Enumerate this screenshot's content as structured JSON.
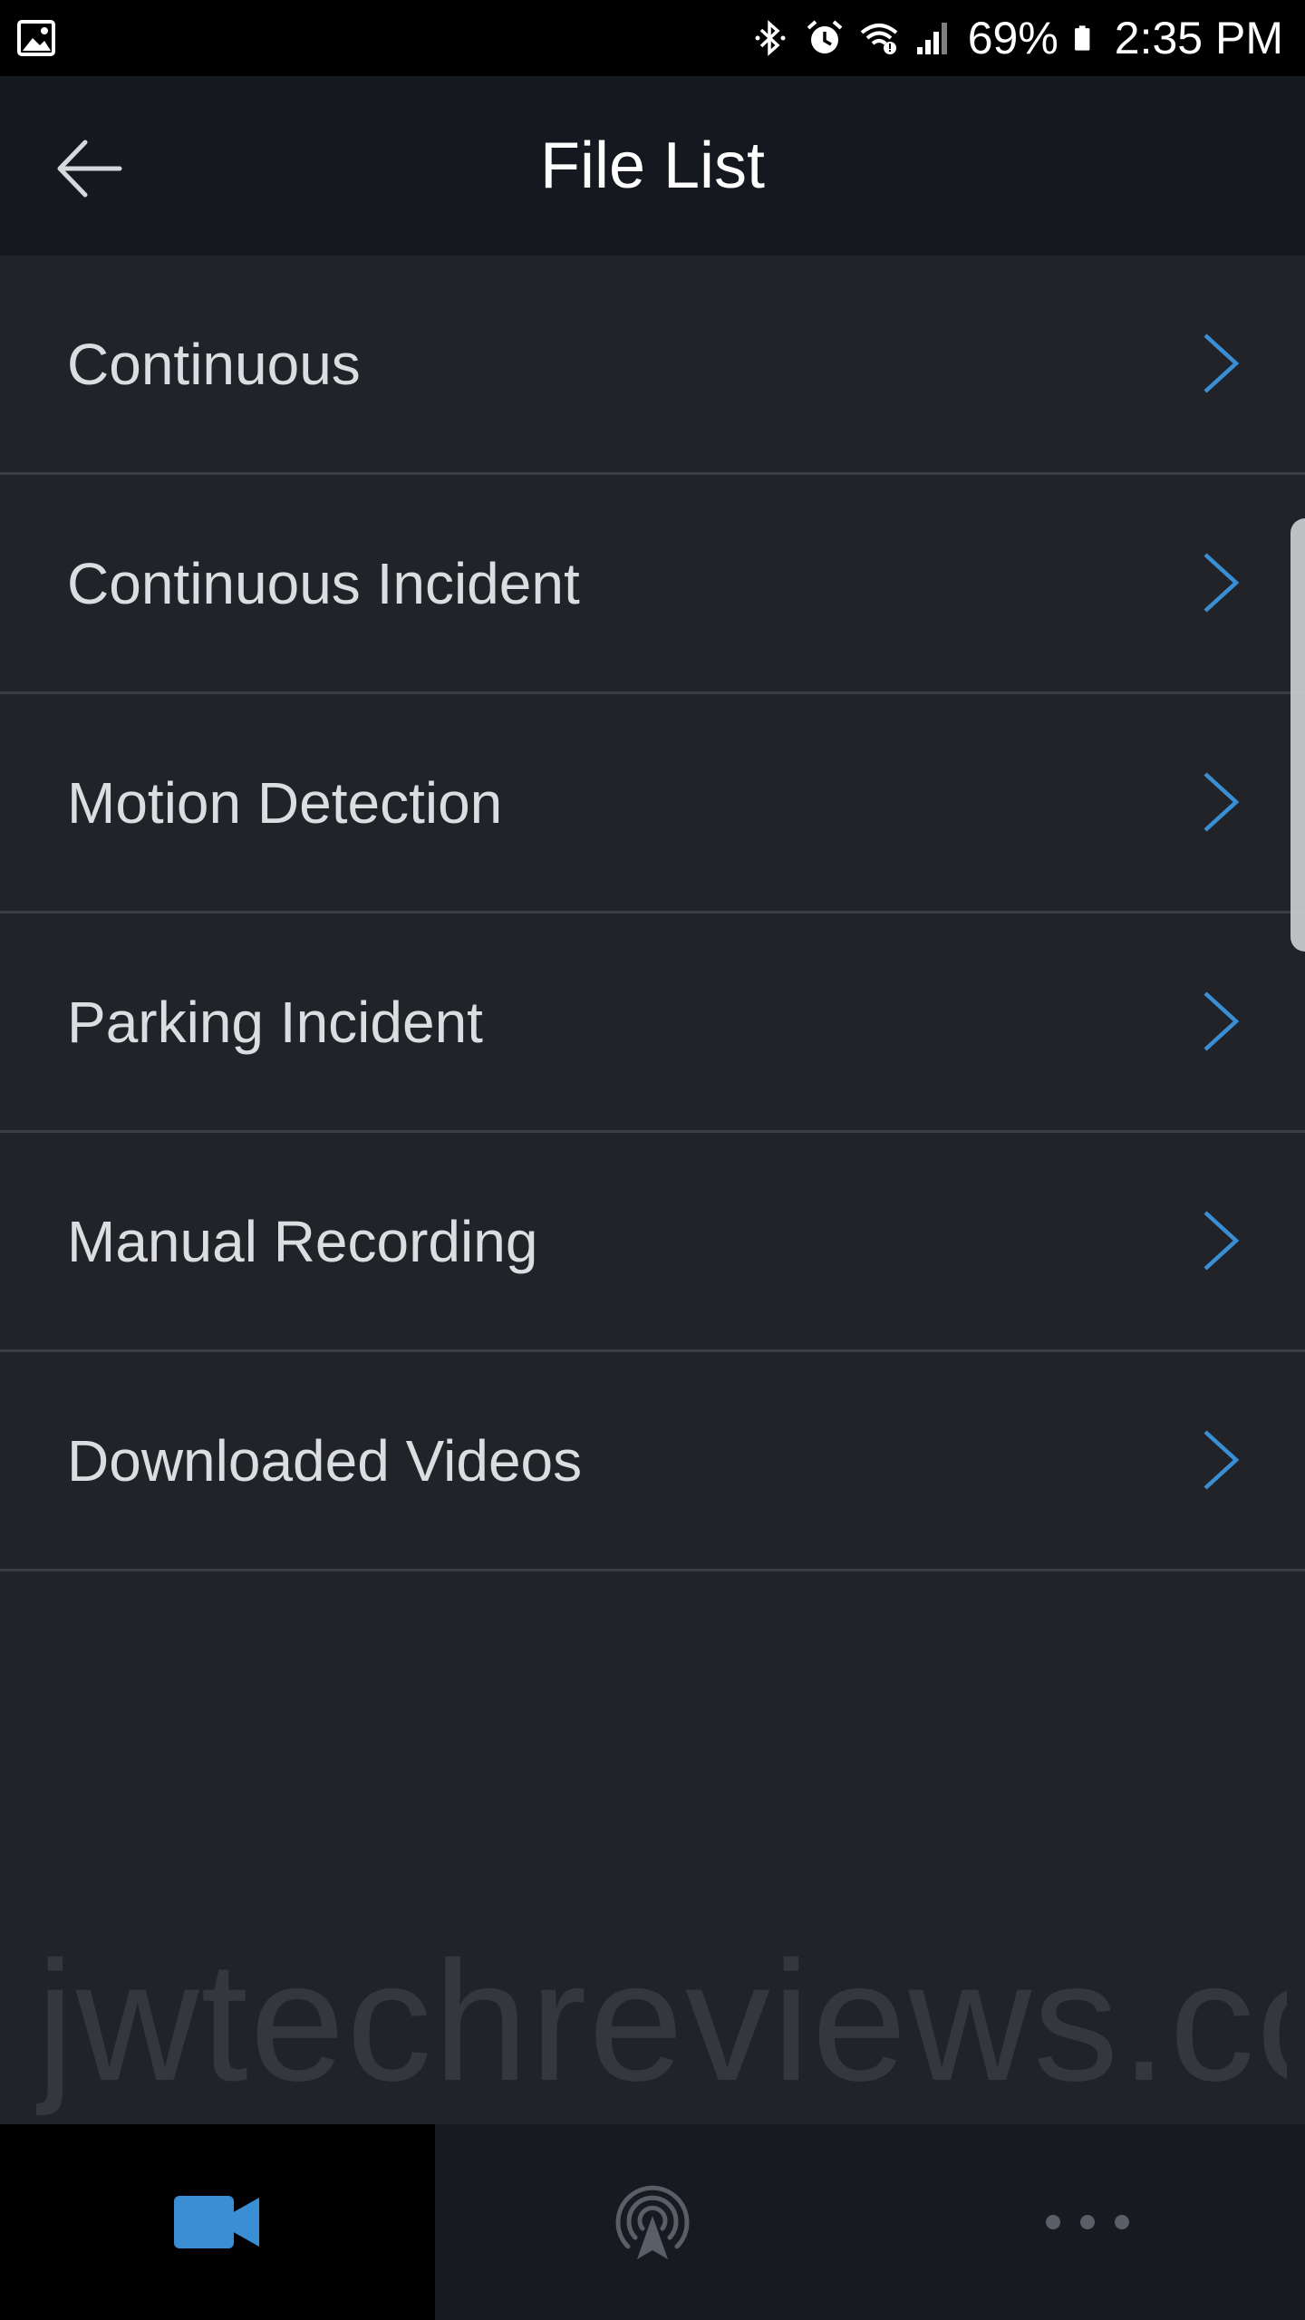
{
  "status_bar": {
    "battery": "69%",
    "time": "2:35 PM",
    "icons": [
      "image-icon",
      "bluetooth-icon",
      "alarm-icon",
      "wifi-icon",
      "signal-icon",
      "battery-icon"
    ]
  },
  "header": {
    "title": "File List",
    "back_icon": "back-arrow-icon"
  },
  "list": {
    "items": [
      {
        "label": "Continuous"
      },
      {
        "label": "Continuous Incident"
      },
      {
        "label": "Motion Detection"
      },
      {
        "label": "Parking Incident"
      },
      {
        "label": "Manual Recording"
      },
      {
        "label": "Downloaded Videos"
      }
    ],
    "chevron_icon": "chevron-right-icon"
  },
  "watermark": "jwtechreviews.com",
  "tabs": [
    {
      "icon": "video-camera-icon",
      "active": true
    },
    {
      "icon": "broadcast-location-icon",
      "active": false
    },
    {
      "icon": "more-icon",
      "active": false
    }
  ],
  "colors": {
    "accent": "#3a8fd4",
    "background": "#212328",
    "header_bg": "#15181e",
    "divider": "#3a3d43"
  }
}
